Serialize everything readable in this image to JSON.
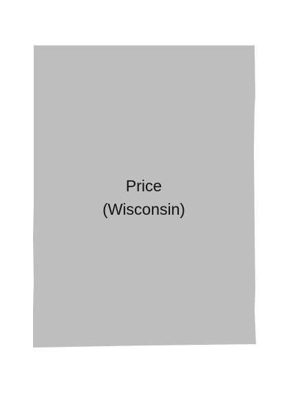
{
  "map": {
    "region": {
      "label_line1": "Price",
      "label_line2": "(Wisconsin)",
      "fill_color": "#bebebe"
    },
    "background_color": "#ffffff"
  }
}
